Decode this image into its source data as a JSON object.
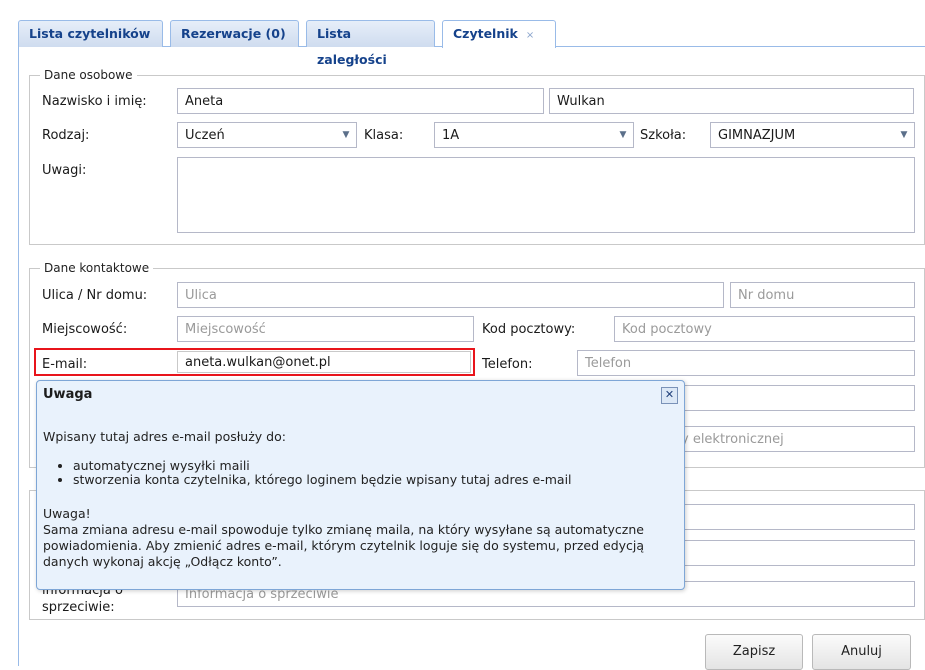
{
  "tabs": [
    {
      "label": "Lista czytelników"
    },
    {
      "label": "Rezerwacje (0)"
    },
    {
      "label": "Lista zaległości"
    },
    {
      "label": "Czytelnik",
      "close": "×"
    }
  ],
  "personal": {
    "legend": "Dane osobowe",
    "name_label": "Nazwisko i imię:",
    "first_name": "Aneta",
    "last_name": "Wulkan",
    "type_label": "Rodzaj:",
    "type_value": "Uczeń",
    "class_label": "Klasa:",
    "class_value": "1A",
    "school_label": "Szkoła:",
    "school_value": "GIMNAZJUM",
    "notes_label": "Uwagi:",
    "notes_value": ""
  },
  "contact": {
    "legend": "Dane kontaktowe",
    "street_label": "Ulica / Nr domu:",
    "street_placeholder": "Ulica",
    "house_placeholder": "Nr domu",
    "city_label": "Miejscowość:",
    "city_placeholder": "Miejscowość",
    "postal_label": "Kod pocztowy:",
    "postal_placeholder": "Kod pocztowy",
    "email_label": "E-mail:",
    "email_value": "aneta.wulkan@onet.pl",
    "phone_label": "Telefon:",
    "phone_placeholder": "Telefon",
    "partial_placeholder": "y elektronicznej"
  },
  "other": {
    "objection_label_line1": "informacja o",
    "objection_label_line2": "sprzeciwie:",
    "objection_placeholder": "Informacja o sprzeciwie"
  },
  "tooltip": {
    "title": "Uwaga",
    "close": "✕",
    "intro": "Wpisany tutaj adres e-mail posłuży do:",
    "bullets": [
      "automatycznej wysyłki maili",
      "stworzenia konta czytelnika, którego loginem będzie wpisany tutaj adres e-mail"
    ],
    "warn_title": "Uwaga!",
    "warn_line1": "Sama zmiana adresu e-mail spowoduje tylko zmianę maila, na który wysyłane są automatyczne",
    "warn_line2": "powiadomienia. Aby zmienić adres e-mail, którym czytelnik loguje się do systemu, przed edycją",
    "warn_line3": "danych wykonaj akcję „Odłącz konto”."
  },
  "buttons": {
    "save": "Zapisz",
    "cancel": "Anuluj"
  },
  "colors": {
    "highlight": "#e8141b",
    "tab_text": "#15428b",
    "tooltip_bg": "#e9f2fc"
  }
}
